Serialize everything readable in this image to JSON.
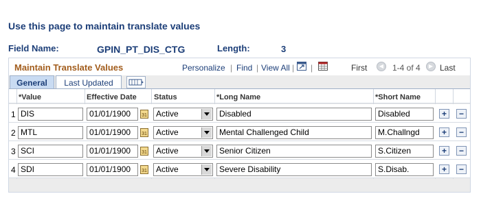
{
  "page": {
    "instruction": "Use this page to maintain translate values",
    "field_name_label": "Field Name:",
    "field_name_value": "GPIN_PT_DIS_CTG",
    "length_label": "Length:",
    "length_value": "3"
  },
  "grid": {
    "title": "Maintain Translate Values",
    "personalize": "Personalize",
    "find": "Find",
    "view_all": "View All",
    "separator": "|",
    "first": "First",
    "count": "1-4 of 4",
    "last": "Last",
    "tabs": [
      "General",
      "Last Updated"
    ],
    "columns": {
      "value": "*Value",
      "effective_date": "Effective Date",
      "status": "Status",
      "long_name": "*Long Name",
      "short_name": "*Short Name"
    },
    "rows": [
      {
        "num": "1",
        "value": "DIS",
        "date": "01/01/1900",
        "status": "Active",
        "long_name": "Disabled",
        "short_name": "Disabled"
      },
      {
        "num": "2",
        "value": "MTL",
        "date": "01/01/1900",
        "status": "Active",
        "long_name": "Mental Challenged Child",
        "short_name": "M.Challngd"
      },
      {
        "num": "3",
        "value": "SCI",
        "date": "01/01/1900",
        "status": "Active",
        "long_name": "Senior Citizen",
        "short_name": "S.Citizen"
      },
      {
        "num": "4",
        "value": "SDI",
        "date": "01/01/1900",
        "status": "Active",
        "long_name": "Severe Disability",
        "short_name": "S.Disab."
      }
    ],
    "add_glyph": "+",
    "delete_glyph": "−",
    "calendar_glyph": "31"
  },
  "colors": {
    "heading": "#1c3e78",
    "grid_title": "#a25d1d",
    "active_tab": "#c9dbf2"
  }
}
